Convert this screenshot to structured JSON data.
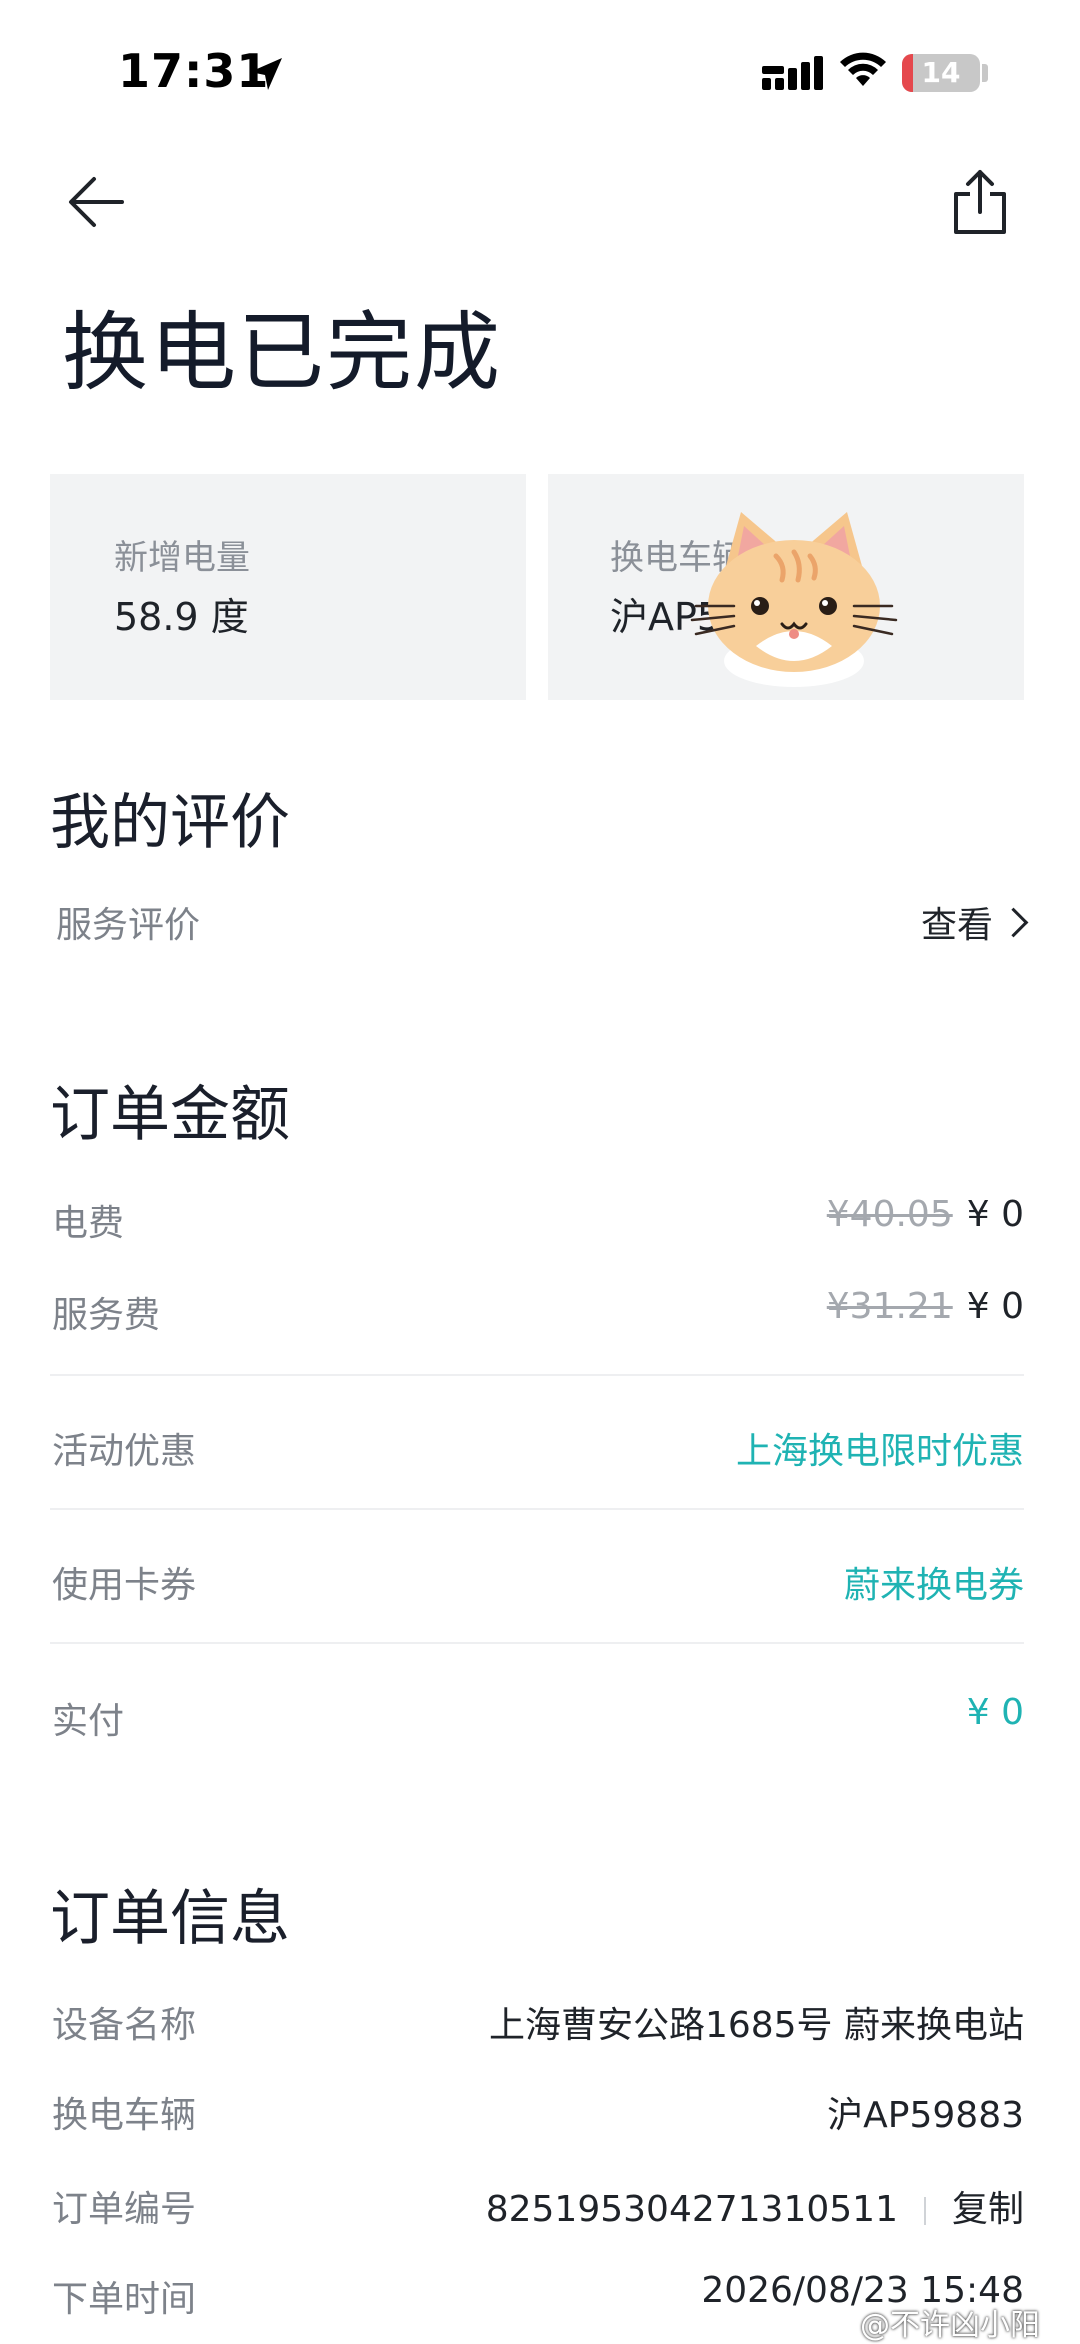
{
  "status_bar": {
    "time": "17:31",
    "battery_level": "14",
    "battery_fraction": 0.14
  },
  "header": {
    "title": "换电已完成"
  },
  "stats": [
    {
      "label": "新增电量",
      "value": "58.9 度"
    },
    {
      "label": "换电车辆",
      "value": "沪AP59883"
    }
  ],
  "review": {
    "title": "我的评价",
    "row_label": "服务评价",
    "action_label": "查看"
  },
  "amount": {
    "title": "订单金额",
    "rows": [
      {
        "label": "电费",
        "original": "¥40.05",
        "value": "¥ 0"
      },
      {
        "label": "服务费",
        "original": "¥31.21",
        "value": "¥ 0"
      }
    ],
    "promo_label": "活动优惠",
    "promo_value": "上海换电限时优惠",
    "coupon_label": "使用卡券",
    "coupon_value": "蔚来换电券",
    "paid_label": "实付",
    "paid_value": "¥ 0"
  },
  "order": {
    "title": "订单信息",
    "device_label": "设备名称",
    "device_value": "上海曹安公路1685号 蔚来换电站",
    "vehicle_label": "换电车辆",
    "vehicle_value": "沪AP59883",
    "number_label": "订单编号",
    "number_value": "825195304271310511",
    "copy_label": "复制",
    "time_label": "下单时间",
    "time_value": "2026/08/23 15:48"
  },
  "watermark": "@不许凶小阳",
  "colors": {
    "accent": "#1fb3b3",
    "card_bg": "#f2f3f4",
    "battery_low": "#e5484d"
  },
  "icons": [
    "location-arrow-icon",
    "cellular-signal-icon",
    "wifi-icon",
    "back-arrow-icon",
    "share-icon",
    "chevron-right-icon",
    "cat-sticker-icon"
  ]
}
